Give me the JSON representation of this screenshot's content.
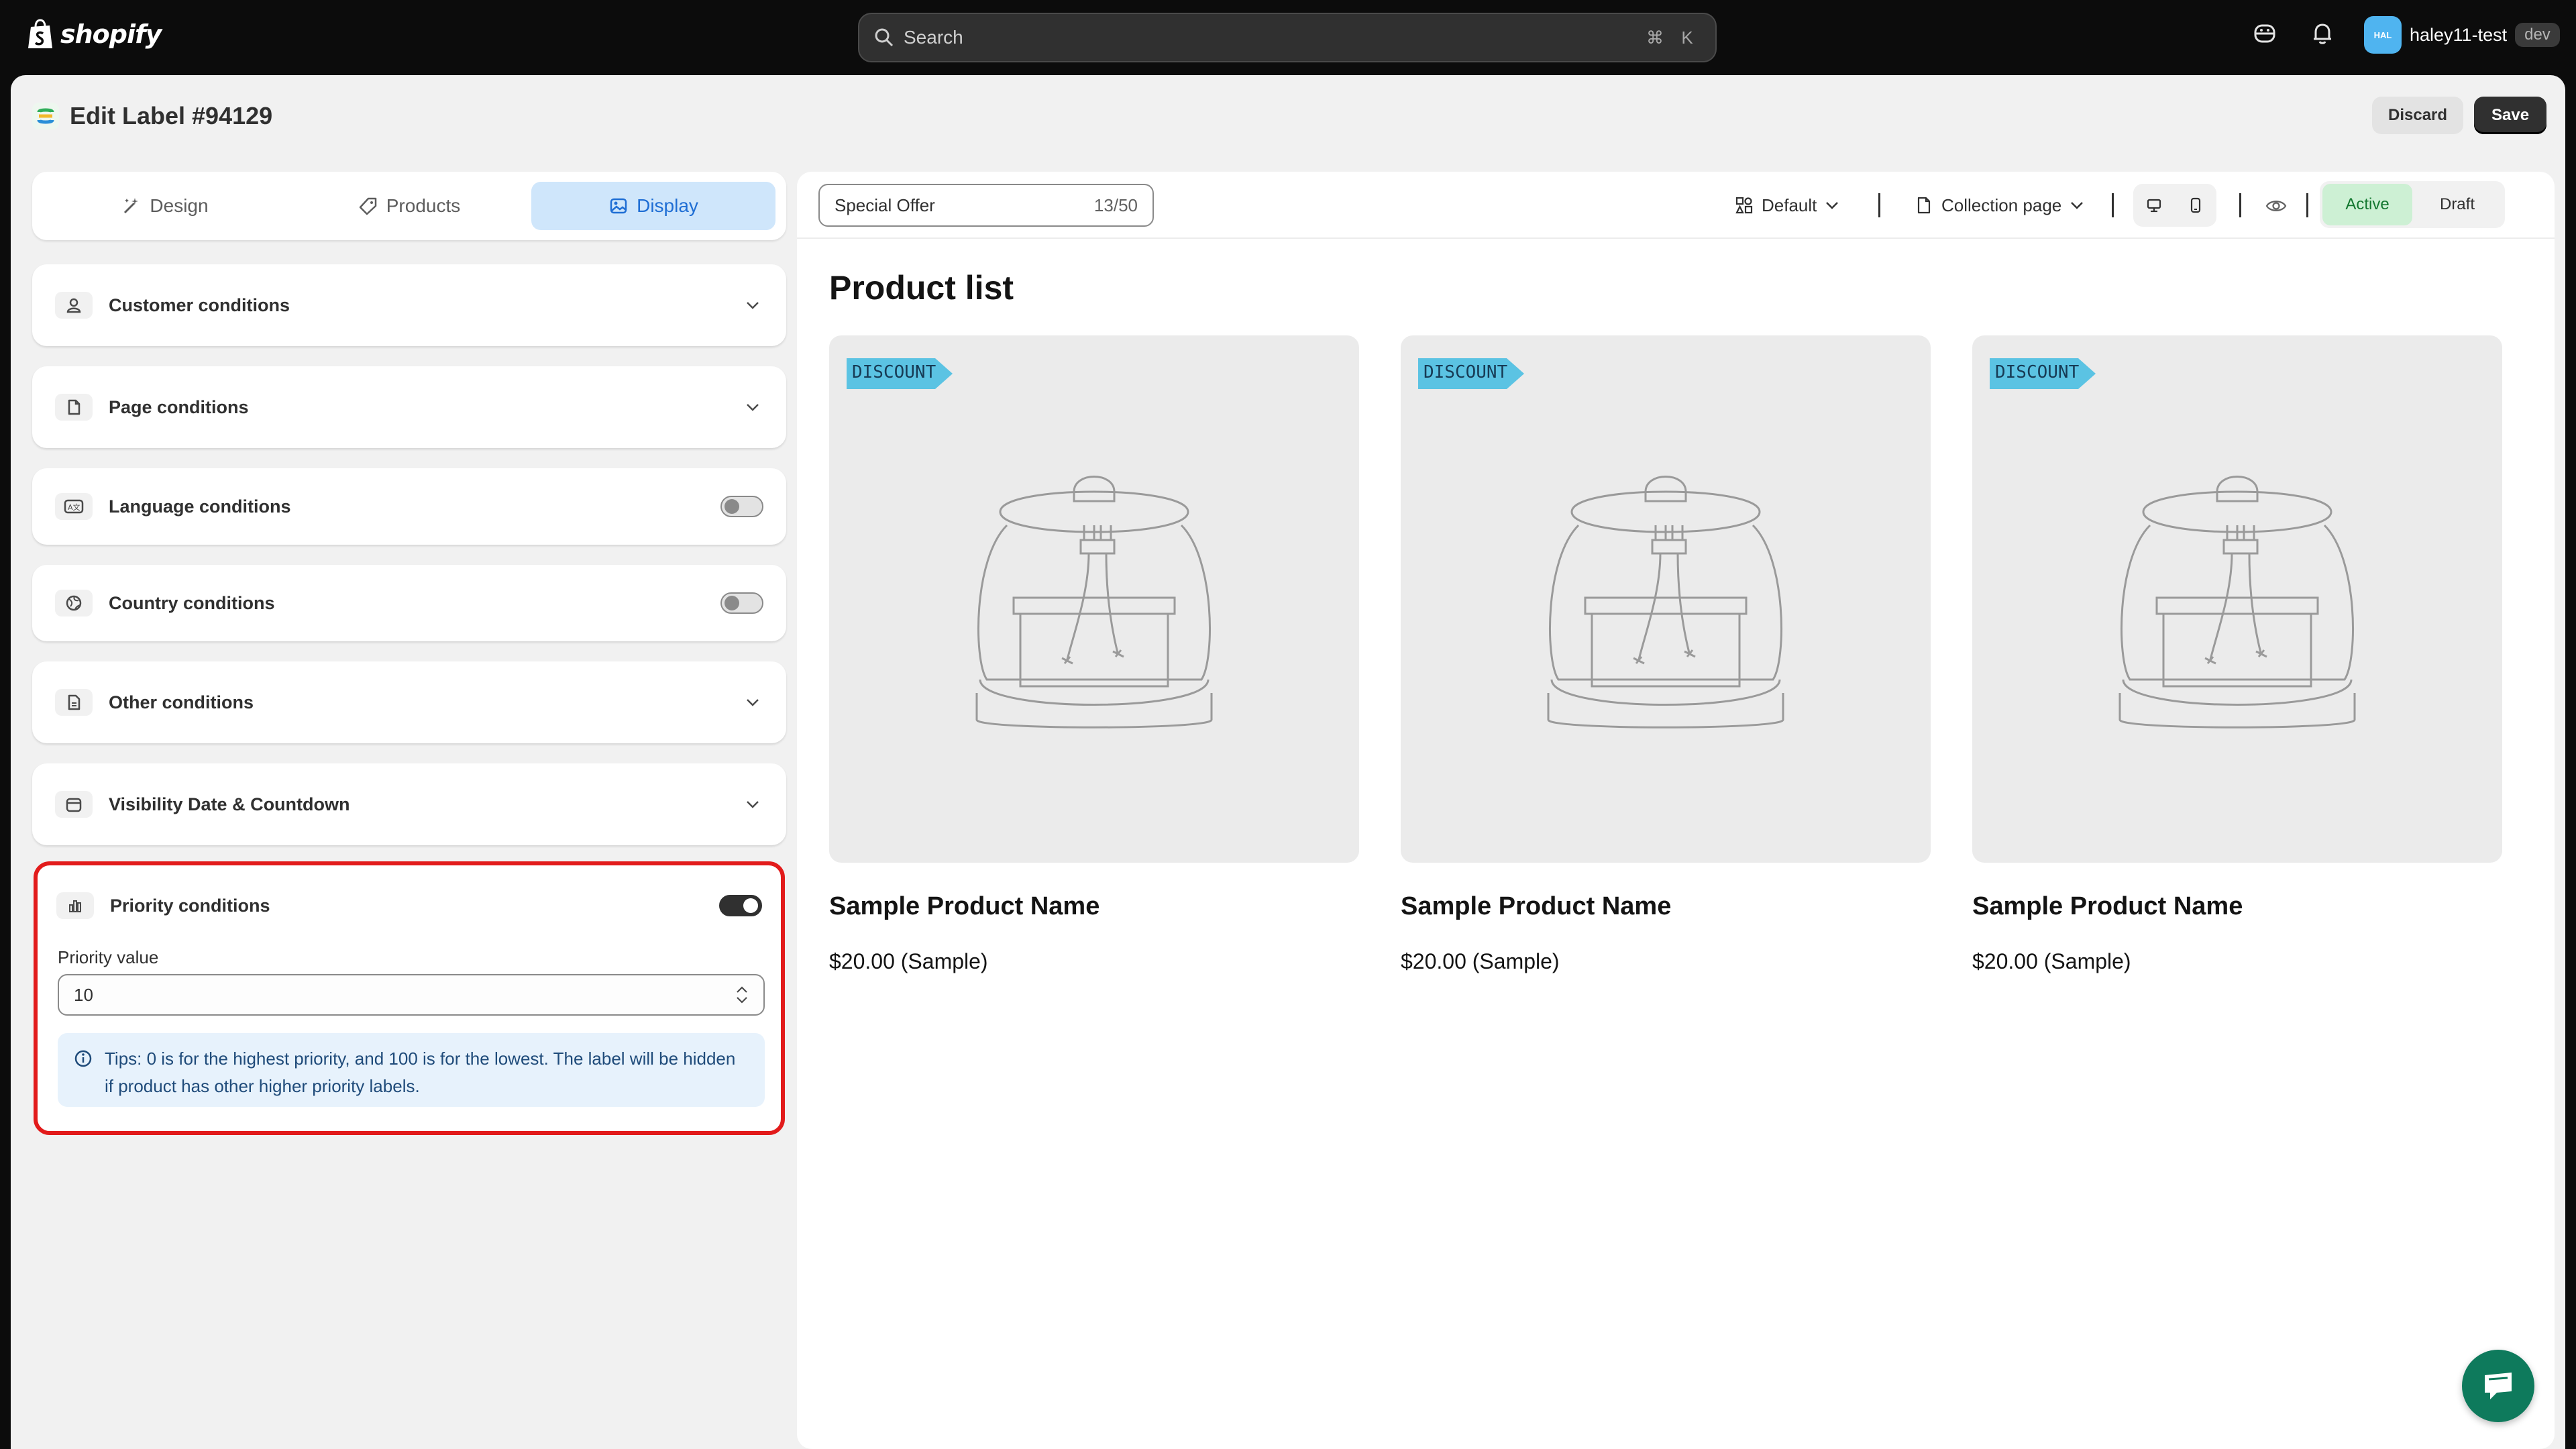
{
  "topbar": {
    "brand": "shopify",
    "search_placeholder": "Search",
    "shortcut_cmd": "⌘",
    "shortcut_key": "K",
    "avatar_initials": "HAL",
    "store_name": "haley11-test",
    "store_tag": "dev"
  },
  "page": {
    "title": "Edit Label #94129",
    "discard_label": "Discard",
    "save_label": "Save"
  },
  "tabs": [
    {
      "label": "Design",
      "active": false
    },
    {
      "label": "Products",
      "active": false
    },
    {
      "label": "Display",
      "active": true
    }
  ],
  "conditions": [
    {
      "label": "Customer conditions",
      "control": "chevron"
    },
    {
      "label": "Page conditions",
      "control": "chevron"
    },
    {
      "label": "Language conditions",
      "control": "toggle-off"
    },
    {
      "label": "Country conditions",
      "control": "toggle-off"
    },
    {
      "label": "Other conditions",
      "control": "chevron"
    },
    {
      "label": "Visibility Date & Countdown",
      "control": "chevron"
    }
  ],
  "priority": {
    "label": "Priority conditions",
    "enabled": true,
    "value_label": "Priority value",
    "value": "10",
    "tip": "Tips: 0 is for the highest priority, and 100 is for the lowest. The label will be hidden if product has other higher priority labels."
  },
  "preview": {
    "label_name": "Special Offer",
    "label_count": "13/50",
    "template": "Default",
    "page_type": "Collection page",
    "status_active": "Active",
    "status_draft": "Draft",
    "selected_status": "Active",
    "list_title": "Product list",
    "badge_text": "DISCOUNT",
    "products": [
      {
        "name": "Sample Product Name",
        "price": "$20.00 (Sample)"
      },
      {
        "name": "Sample Product Name",
        "price": "$20.00 (Sample)"
      },
      {
        "name": "Sample Product Name",
        "price": "$20.00 (Sample)"
      }
    ]
  },
  "colors": {
    "accent_blue": "#1f6ed4",
    "active_green": "#12772f",
    "highlight_red": "#e21b1b",
    "badge_blue": "#5bc3e3",
    "chat_green": "#0e7a5c"
  }
}
